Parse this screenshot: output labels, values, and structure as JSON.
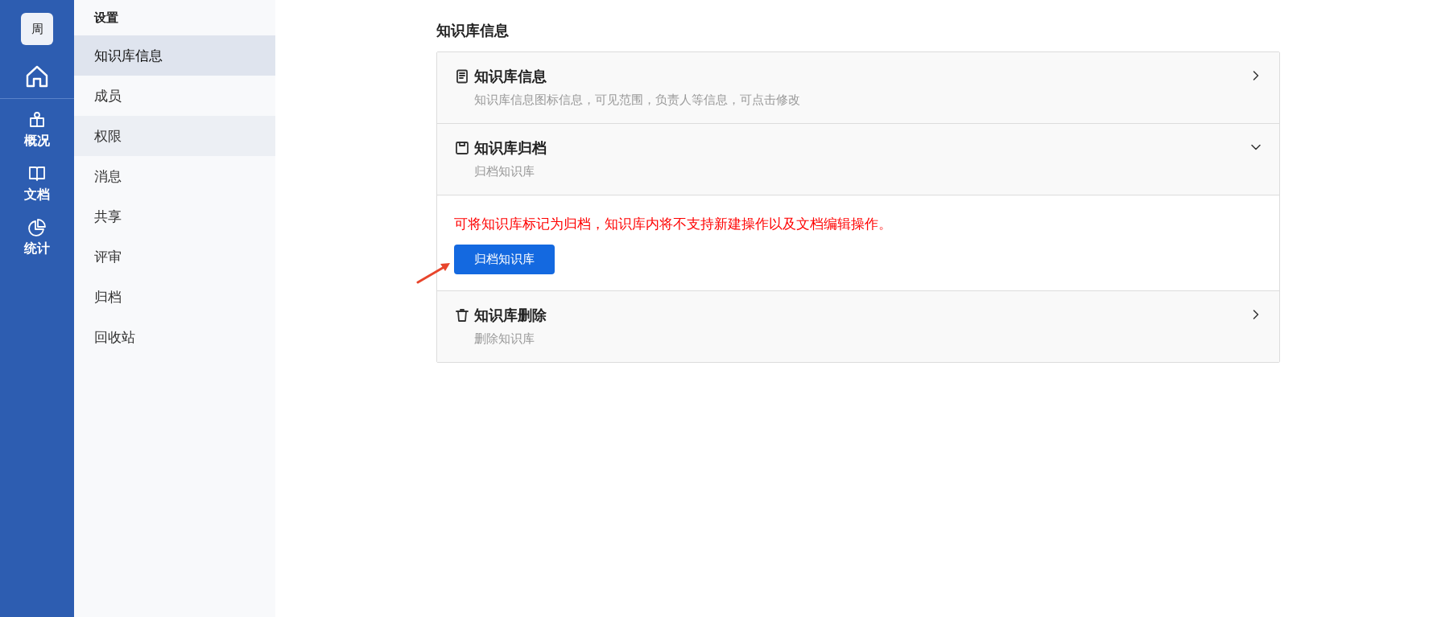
{
  "rail": {
    "avatar": "周",
    "items": [
      {
        "label": "概况"
      },
      {
        "label": "文档"
      },
      {
        "label": "统计"
      }
    ]
  },
  "sidebar": {
    "title": "设置",
    "items": [
      {
        "label": "知识库信息",
        "selected": true,
        "hovered": false
      },
      {
        "label": "成员",
        "selected": false,
        "hovered": false
      },
      {
        "label": "权限",
        "selected": false,
        "hovered": true
      },
      {
        "label": "消息",
        "selected": false,
        "hovered": false
      },
      {
        "label": "共享",
        "selected": false,
        "hovered": false
      },
      {
        "label": "评审",
        "selected": false,
        "hovered": false
      },
      {
        "label": "归档",
        "selected": false,
        "hovered": false
      },
      {
        "label": "回收站",
        "selected": false,
        "hovered": false
      }
    ]
  },
  "main": {
    "heading": "知识库信息",
    "sections": [
      {
        "title": "知识库信息",
        "description": "知识库信息图标信息，可见范围，负责人等信息，可点击修改",
        "expanded": false
      },
      {
        "title": "知识库归档",
        "description": "归档知识库",
        "expanded": true,
        "notice": "可将知识库标记为归档，知识库内将不支持新建操作以及文档编辑操作。",
        "button": "归档知识库"
      },
      {
        "title": "知识库删除",
        "description": "删除知识库",
        "expanded": false
      }
    ]
  }
}
